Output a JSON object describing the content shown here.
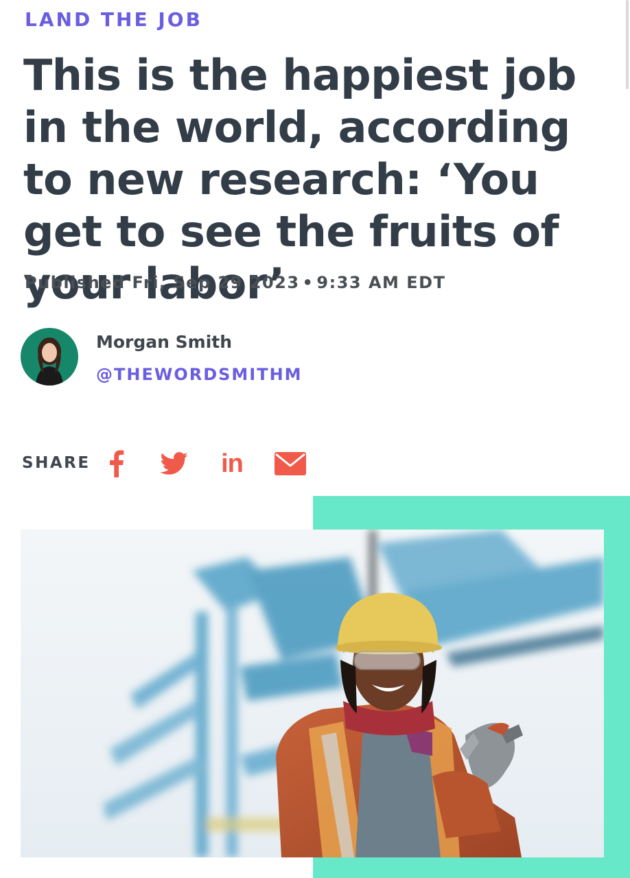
{
  "article": {
    "kicker": "LAND THE JOB",
    "headline": "This is the happiest job in the world, according to new research: ‘You get to see the fruits of your labor’",
    "published_date": "Published Fri, Sep 29 2023",
    "published_separator": "•",
    "published_time": "9:33 AM EDT"
  },
  "author": {
    "name": "Morgan Smith",
    "handle": "@THEWORDSMITHM"
  },
  "share": {
    "label": "SHARE",
    "buttons": [
      {
        "icon": "facebook-icon"
      },
      {
        "icon": "twitter-icon"
      },
      {
        "icon": "linkedin-icon",
        "text": "in"
      },
      {
        "icon": "email-icon"
      }
    ]
  },
  "colors": {
    "accent_purple": "#6a5ee0",
    "headline_text": "#333d47",
    "share_icon": "#f05a4a",
    "accent_block": "#67e8c8"
  }
}
